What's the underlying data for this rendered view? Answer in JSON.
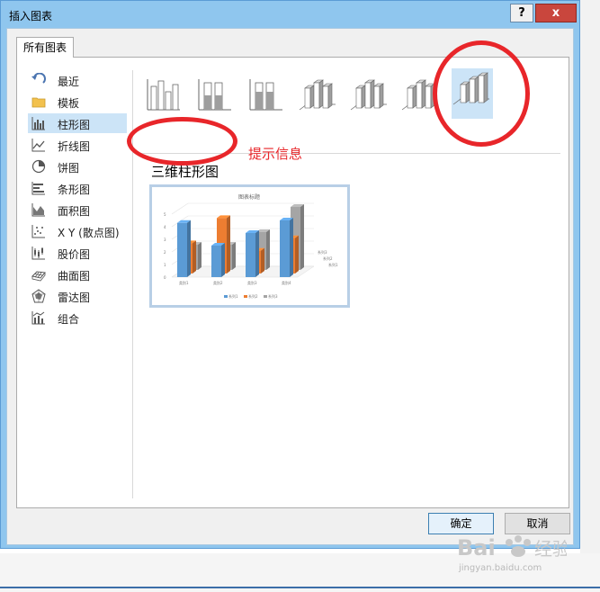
{
  "window": {
    "title": "插入图表",
    "help_label": "?",
    "close_label": "x"
  },
  "tabs": [
    {
      "label": "所有图表"
    }
  ],
  "sidebar": {
    "items": [
      {
        "label": "最近",
        "icon": "recent-icon"
      },
      {
        "label": "模板",
        "icon": "folder-icon"
      },
      {
        "label": "柱形图",
        "icon": "column-chart-icon",
        "selected": true
      },
      {
        "label": "折线图",
        "icon": "line-chart-icon"
      },
      {
        "label": "饼图",
        "icon": "pie-chart-icon"
      },
      {
        "label": "条形图",
        "icon": "bar-chart-icon"
      },
      {
        "label": "面积图",
        "icon": "area-chart-icon"
      },
      {
        "label": "X Y (散点图)",
        "icon": "scatter-chart-icon"
      },
      {
        "label": "股价图",
        "icon": "stock-chart-icon"
      },
      {
        "label": "曲面图",
        "icon": "surface-chart-icon"
      },
      {
        "label": "雷达图",
        "icon": "radar-chart-icon"
      },
      {
        "label": "组合",
        "icon": "combo-chart-icon"
      }
    ]
  },
  "subtypes": [
    {
      "name": "clustered-column"
    },
    {
      "name": "stacked-column"
    },
    {
      "name": "percent-stacked-column"
    },
    {
      "name": "3d-clustered-column"
    },
    {
      "name": "3d-stacked-column"
    },
    {
      "name": "3d-percent-stacked-column"
    },
    {
      "name": "3d-column",
      "selected": true
    }
  ],
  "selected_subtype_label": "三维柱形图",
  "annotation": "提示信息",
  "preview": {
    "title": "图表标题",
    "yticks": [
      "5",
      "4",
      "3",
      "2",
      "1",
      "0"
    ],
    "categories": [
      "类别1",
      "类别2",
      "类别3",
      "类别4"
    ],
    "depth_labels": [
      "系列3",
      "系列2",
      "系列1"
    ],
    "legend": [
      "系列1",
      "系列2",
      "系列3"
    ],
    "series_colors": [
      "#5b9bd5",
      "#ed7d31",
      "#a5a5a5"
    ],
    "values": [
      [
        4.3,
        2.5,
        3.5,
        4.5
      ],
      [
        2.4,
        4.4,
        1.8,
        2.8
      ],
      [
        2,
        2,
        3,
        5
      ]
    ]
  },
  "buttons": {
    "ok": "确定",
    "cancel": "取消"
  },
  "watermark": "jingyan.baidu.com"
}
